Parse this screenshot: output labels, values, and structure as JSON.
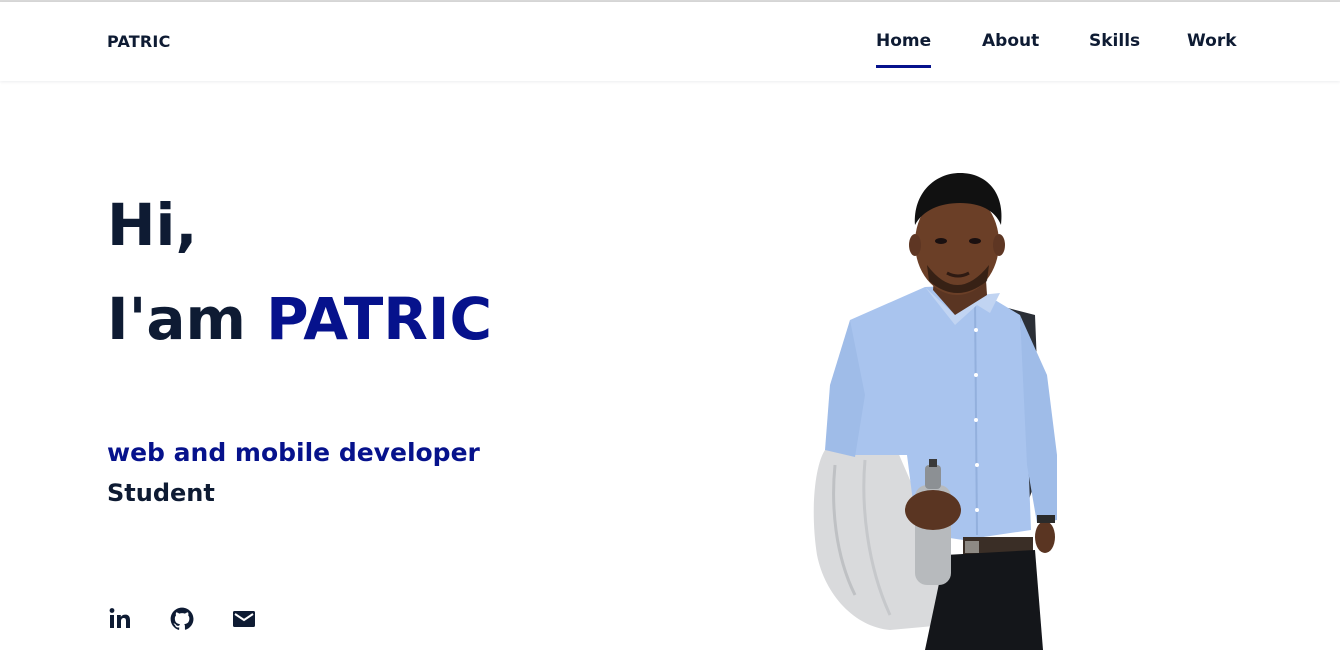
{
  "header": {
    "logo": "PATRIC",
    "nav": [
      {
        "label": "Home",
        "active": true
      },
      {
        "label": "About",
        "active": false
      },
      {
        "label": "Skills",
        "active": false
      },
      {
        "label": "Work",
        "active": false
      }
    ]
  },
  "hero": {
    "greeting": "Hi,",
    "intro": "I'am",
    "name": "PATRIC",
    "role": "web and mobile developer",
    "status": "Student"
  },
  "social": [
    {
      "icon": "linkedin-icon"
    },
    {
      "icon": "github-icon"
    },
    {
      "icon": "email-icon"
    }
  ],
  "photo": {
    "subject": "person-portrait"
  },
  "colors": {
    "accent": "#06128c",
    "text": "#0e1b33",
    "background": "#ffffff",
    "shirt": "#a9c4ee"
  }
}
